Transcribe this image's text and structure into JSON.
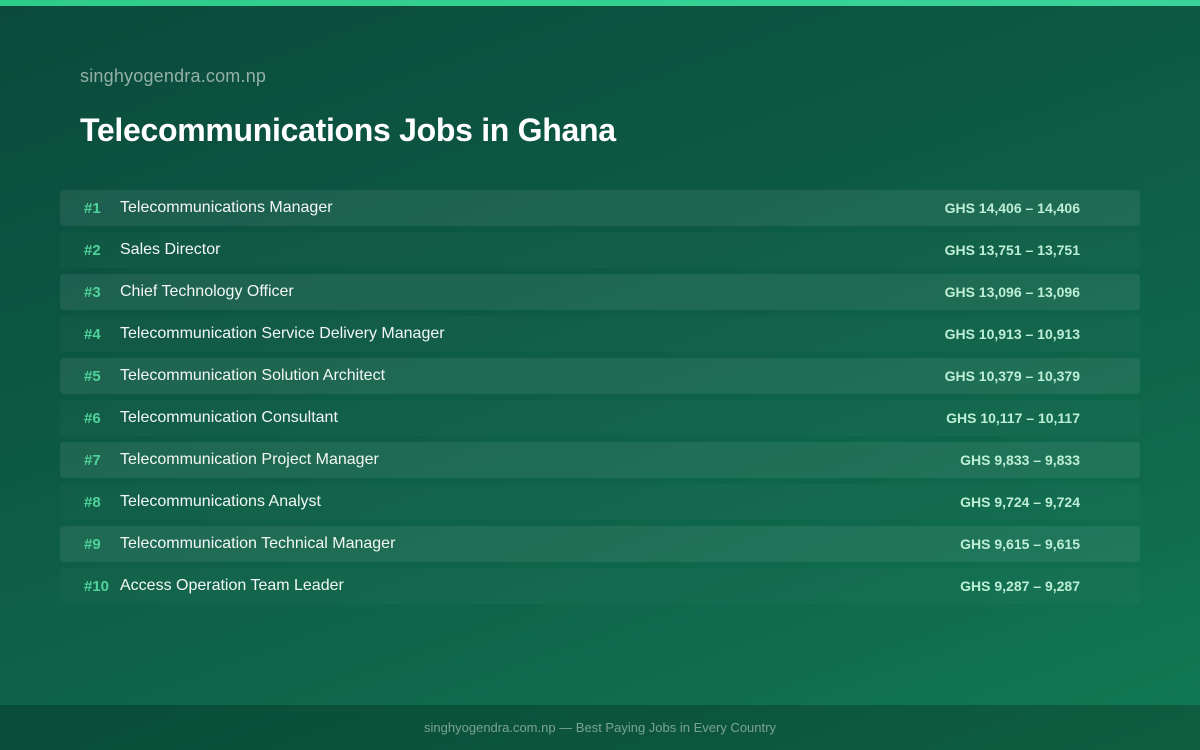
{
  "header": {
    "site_name": "singhyogendra.com.np",
    "title": "Telecommunications Jobs in Ghana"
  },
  "jobs": [
    {
      "rank": "#1",
      "title": "Telecommunications Manager",
      "salary": "GHS 14,406 – 14,406"
    },
    {
      "rank": "#2",
      "title": "Sales Director",
      "salary": "GHS 13,751 – 13,751"
    },
    {
      "rank": "#3",
      "title": "Chief Technology Officer",
      "salary": "GHS 13,096 – 13,096"
    },
    {
      "rank": "#4",
      "title": "Telecommunication Service Delivery Manager",
      "salary": "GHS 10,913 – 10,913"
    },
    {
      "rank": "#5",
      "title": "Telecommunication Solution Architect",
      "salary": "GHS 10,379 – 10,379"
    },
    {
      "rank": "#6",
      "title": "Telecommunication Consultant",
      "salary": "GHS 10,117 – 10,117"
    },
    {
      "rank": "#7",
      "title": "Telecommunication Project Manager",
      "salary": "GHS 9,833 – 9,833"
    },
    {
      "rank": "#8",
      "title": "Telecommunications Analyst",
      "salary": "GHS 9,724 – 9,724"
    },
    {
      "rank": "#9",
      "title": "Telecommunication Technical Manager",
      "salary": "GHS 9,615 – 9,615"
    },
    {
      "rank": "#10",
      "title": "Access Operation Team Leader",
      "salary": "GHS 9,287 – 9,287"
    }
  ],
  "footer": {
    "text": "singhyogendra.com.np — Best Paying Jobs in Every Country"
  },
  "colors": {
    "accent": "#4fd39a",
    "top_bar": "#2ecc8a",
    "background": "#0d5a44"
  }
}
